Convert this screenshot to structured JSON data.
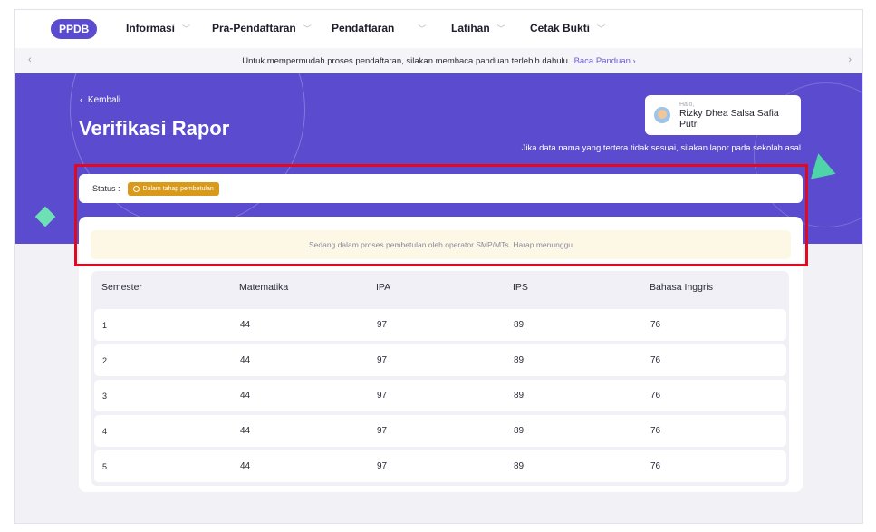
{
  "nav": {
    "logo": "PPDB",
    "items": [
      {
        "label": "Informasi"
      },
      {
        "label": "Pra-Pendaftaran"
      },
      {
        "label": "Pendaftaran"
      },
      {
        "label": "Latihan"
      },
      {
        "label": "Cetak Bukti"
      }
    ]
  },
  "announcement": {
    "text": "Untuk mempermudah proses pendaftaran, silakan membaca panduan terlebih dahulu.",
    "link": "Baca Panduan ›"
  },
  "hero": {
    "back_label": "Kembali",
    "title": "Verifikasi Rapor",
    "greeting": "Halo,",
    "user_name": "Rizky Dhea Salsa Safia Putri",
    "note": "Jika data nama yang tertera tidak sesuai, silakan lapor pada sekolah asal"
  },
  "status": {
    "label": "Status :",
    "badge": "Dalam tahap pembetulan",
    "badge_color": "#d99a1c"
  },
  "notice": "Sedang dalam proses pembetulan oleh operator SMP/MTs. Harap menunggu",
  "table": {
    "headers": [
      "Semester",
      "Matematika",
      "IPA",
      "IPS",
      "Bahasa Inggris"
    ],
    "rows": [
      [
        "1",
        "44",
        "97",
        "89",
        "76"
      ],
      [
        "2",
        "44",
        "97",
        "89",
        "76"
      ],
      [
        "3",
        "44",
        "97",
        "89",
        "76"
      ],
      [
        "4",
        "44",
        "97",
        "89",
        "76"
      ],
      [
        "5",
        "44",
        "97",
        "89",
        "76"
      ]
    ]
  },
  "colors": {
    "brand": "#5a4bcf",
    "highlight": "#e0091f"
  }
}
